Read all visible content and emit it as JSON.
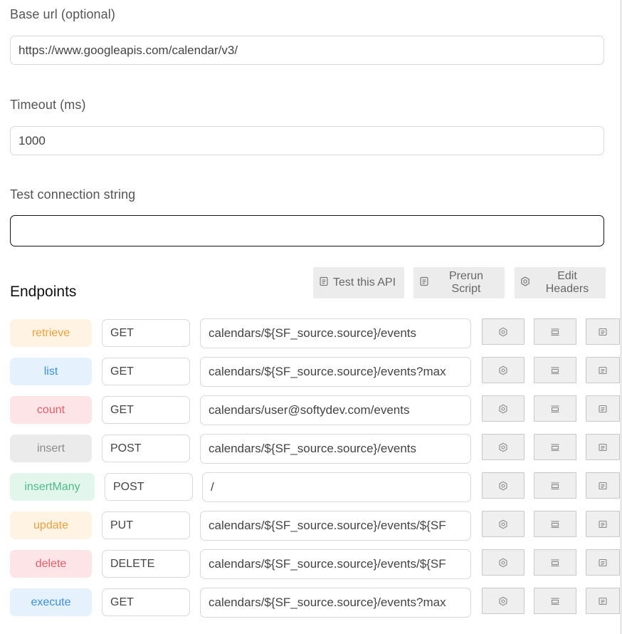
{
  "base_url": {
    "label": "Base url (optional)",
    "value": "https://www.googleapis.com/calendar/v3/"
  },
  "timeout": {
    "label": "Timeout (ms)",
    "value": "1000"
  },
  "test_connection": {
    "label": "Test connection string",
    "value": ""
  },
  "endpoints_title": "Endpoints",
  "toolbar": {
    "test_api": "Test this API",
    "prerun_script": "Prerun Script",
    "edit_headers": "Edit Headers"
  },
  "endpoints": [
    {
      "name": "retrieve",
      "method": "GET",
      "path": "calendars/${SF_source.source}/events",
      "bg": "#fff3e3",
      "fg": "#f0a03c"
    },
    {
      "name": "list",
      "method": "GET",
      "path": "calendars/${SF_source.source}/events?max",
      "bg": "#e6f1fe",
      "fg": "#3b8fe8"
    },
    {
      "name": "count",
      "method": "GET",
      "path": "calendars/user@softydev.com/events",
      "bg": "#fde4e6",
      "fg": "#ec5b6a"
    },
    {
      "name": "insert",
      "method": "POST",
      "path": "calendars/${SF_source.source}/events",
      "bg": "#ebebeb",
      "fg": "#8a8a8a"
    },
    {
      "name": "insertMany",
      "method": "POST",
      "path": "/",
      "bg": "#e2f6ec",
      "fg": "#4fb98a"
    },
    {
      "name": "update",
      "method": "PUT",
      "path": "calendars/${SF_source.source}/events/${SF",
      "bg": "#fff3e3",
      "fg": "#f0a03c"
    },
    {
      "name": "delete",
      "method": "DELETE",
      "path": "calendars/${SF_source.source}/events/${SF",
      "bg": "#fde4e6",
      "fg": "#ec5b6a"
    },
    {
      "name": "execute",
      "method": "GET",
      "path": "calendars/${SF_source.source}/events?max",
      "bg": "#e6f1fe",
      "fg": "#3b8fe8"
    }
  ],
  "icons": {
    "settings": "gear-icon",
    "panel": "panel-icon",
    "document": "document-icon"
  }
}
